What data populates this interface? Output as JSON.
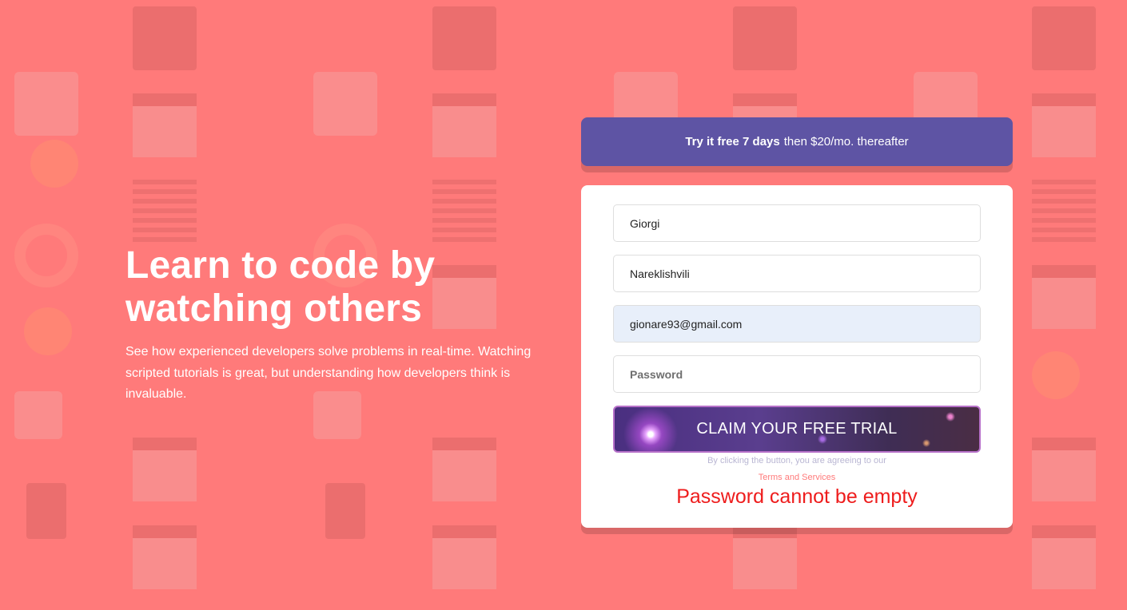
{
  "hero": {
    "title_line1": "Learn to code by",
    "title_line2": "watching others",
    "description": "See how experienced developers solve problems in real-time. Watching scripted tutorials is great, but understanding how developers think is invaluable."
  },
  "promo": {
    "bold": "Try it free 7 days",
    "rest": "then $20/mo. thereafter"
  },
  "form": {
    "first_name_value": "Giorgi",
    "last_name_value": "Nareklishvili",
    "email_value": "gionare93@gmail.com",
    "password_placeholder": "Password",
    "submit_label": "CLAIM YOUR FREE TRIAL",
    "agree_text": "By clicking the button, you are agreeing to our",
    "terms_link": "Terms and Services",
    "error_message": "Password cannot be empty"
  },
  "colors": {
    "background": "#ff7a7a",
    "promo": "#5e54a4",
    "error": "#ee1c1c"
  }
}
